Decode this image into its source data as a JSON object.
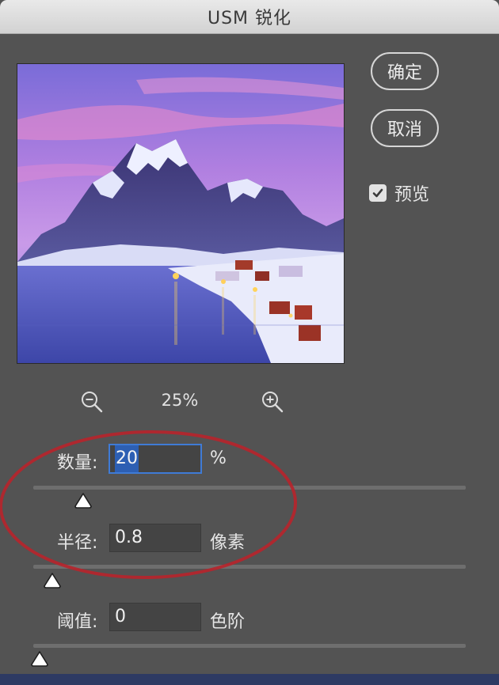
{
  "window": {
    "title": "USM 锐化"
  },
  "buttons": {
    "ok": "确定",
    "cancel": "取消"
  },
  "preview_toggle": {
    "label": "预览",
    "checked": true
  },
  "zoom": {
    "level": "25%"
  },
  "params": [
    {
      "label": "数量:",
      "value": "20",
      "unit": "%",
      "slider_fraction": 0.1
    },
    {
      "label": "半径:",
      "value": "0.8",
      "unit": "像素",
      "slider_fraction": 0.03
    },
    {
      "label": "阈值:",
      "value": "0",
      "unit": "色阶",
      "slider_fraction": 0.0
    }
  ],
  "colors": {
    "annotation": "#b8232b",
    "focus": "#3f7bd6",
    "panel": "#535353"
  }
}
